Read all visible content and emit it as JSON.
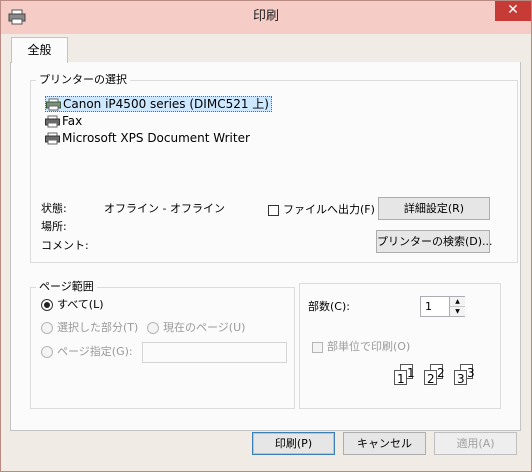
{
  "window": {
    "title": "印刷",
    "close_glyph": "✕",
    "icon": "printer-icon"
  },
  "tabs": [
    {
      "label": "全般",
      "selected": true
    }
  ],
  "printer_group": {
    "title": "プリンターの選択",
    "printers": [
      {
        "name": "Canon iP4500 series (DIMC521 上)",
        "selected": true,
        "icon": "printer-icon"
      },
      {
        "name": "Fax",
        "selected": false,
        "icon": "fax-printer-icon"
      },
      {
        "name": "Microsoft XPS Document Writer",
        "selected": false,
        "icon": "printer-icon"
      }
    ],
    "status_label": "状態:",
    "status_value": "オフライン - オフライン",
    "location_label": "場所:",
    "comment_label": "コメント:",
    "print_to_file_label": "ファイルへ出力(F)",
    "print_to_file_checked": false,
    "preferences_button": "詳細設定(R)",
    "find_printer_button": "プリンターの検索(D)..."
  },
  "page_range": {
    "title": "ページ範囲",
    "all_label": "すべて(L)",
    "selection_label": "選択した部分(T)",
    "current_page_label": "現在のページ(U)",
    "pages_label": "ページ指定(G):",
    "pages_value": "",
    "selected": "all"
  },
  "copies": {
    "label": "部数(C):",
    "value": "1",
    "collate_label": "部単位で印刷(O)",
    "collate_checked": false,
    "collate_pages": [
      "1",
      "1",
      "2",
      "2",
      "3",
      "3"
    ]
  },
  "buttons": {
    "print": "印刷(P)",
    "cancel": "キャンセル",
    "apply": "適用(A)"
  },
  "colors": {
    "titlebar": "#f5ccc6",
    "close": "#c73b37",
    "selection": "#cde8ff",
    "default_button_border": "#3c7fb1"
  }
}
